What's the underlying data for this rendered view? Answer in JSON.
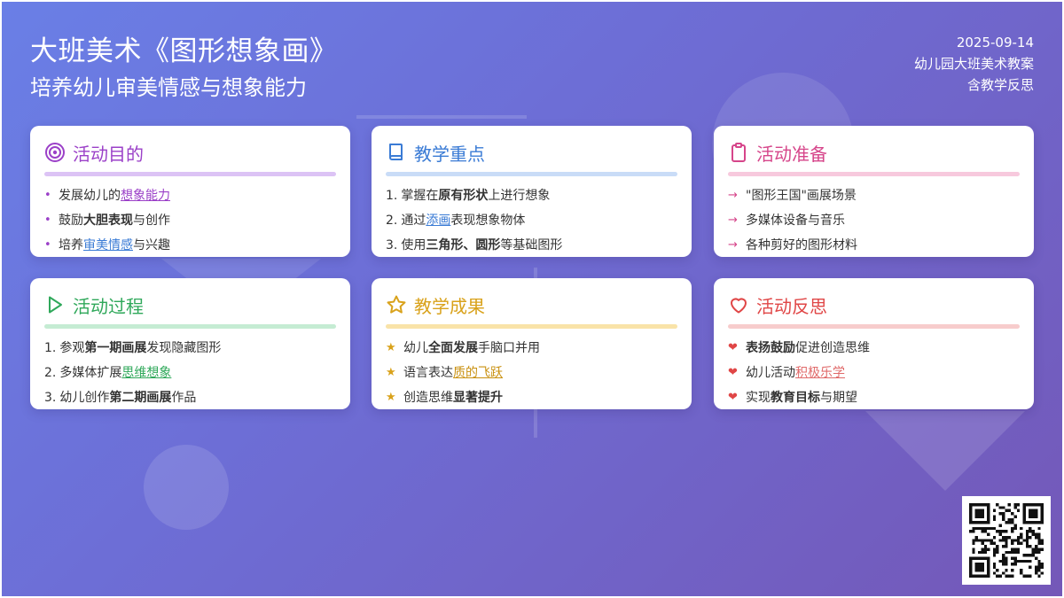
{
  "header": {
    "title": "大班美术《图形想象画》",
    "subtitle": "培养幼儿审美情感与想象能力",
    "date": "2025-09-14",
    "doc_type": "幼儿园大班美术教案",
    "note": "含教学反思"
  },
  "colors": {
    "background_start": "#6a7fe6",
    "background_end": "#7458b8",
    "purple": "#9b40c8",
    "blue": "#3a7bd5",
    "pink": "#d6458a",
    "green": "#2fa85a",
    "gold": "#d9a21b",
    "red": "#e04646"
  },
  "cards": {
    "goals": {
      "icon": "target-icon",
      "title": "活动目的",
      "items": [
        {
          "pre": "发展幼儿的",
          "link": "想象能力",
          "post": ""
        },
        {
          "pre": "鼓励",
          "bold": "大胆表现",
          "post": "与创作"
        },
        {
          "pre": "培养",
          "link": "审美情感",
          "post": "与兴趣"
        }
      ]
    },
    "key_points": {
      "icon": "book-icon",
      "title": "教学重点",
      "items": [
        {
          "num": "1.",
          "pre": "掌握在",
          "bold": "原有形状",
          "post": "上进行想象"
        },
        {
          "num": "2.",
          "pre": "通过",
          "link": "添画",
          "post": "表现想象物体"
        },
        {
          "num": "3.",
          "pre": "使用",
          "bold": "三角形、圆形",
          "post": "等基础图形"
        }
      ]
    },
    "preparation": {
      "icon": "clipboard-icon",
      "marker": "→",
      "title": "活动准备",
      "items": [
        {
          "text": "\"图形王国\"画展场景"
        },
        {
          "text": "多媒体设备与音乐"
        },
        {
          "text": "各种剪好的图形材料"
        }
      ]
    },
    "process": {
      "icon": "play-icon",
      "title": "活动过程",
      "items": [
        {
          "num": "1.",
          "pre": "参观",
          "bold": "第一期画展",
          "post": "发现隐藏图形"
        },
        {
          "num": "2.",
          "pre": "多媒体扩展",
          "link": "思维想象",
          "post": ""
        },
        {
          "num": "3.",
          "pre": "幼儿创作",
          "bold": "第二期画展",
          "post": "作品"
        }
      ]
    },
    "results": {
      "icon": "star-icon",
      "marker": "★",
      "title": "教学成果",
      "items": [
        {
          "pre": "幼儿",
          "bold": "全面发展",
          "post": "手脑口并用"
        },
        {
          "pre": "语言表达",
          "link": "质的飞跃",
          "post": ""
        },
        {
          "pre": "创造思维",
          "bold": "显著提升",
          "post": ""
        }
      ]
    },
    "reflection": {
      "icon": "heart-icon",
      "marker": "❤",
      "title": "活动反思",
      "items": [
        {
          "pre": "",
          "bold": "表扬鼓励",
          "post": "促进创造思维"
        },
        {
          "pre": "幼儿活动",
          "link": "积极乐学",
          "post": ""
        },
        {
          "pre": "实现",
          "bold": "教育目标",
          "post": "与期望"
        }
      ]
    }
  },
  "qr": {
    "icon": "qr-code-icon"
  }
}
